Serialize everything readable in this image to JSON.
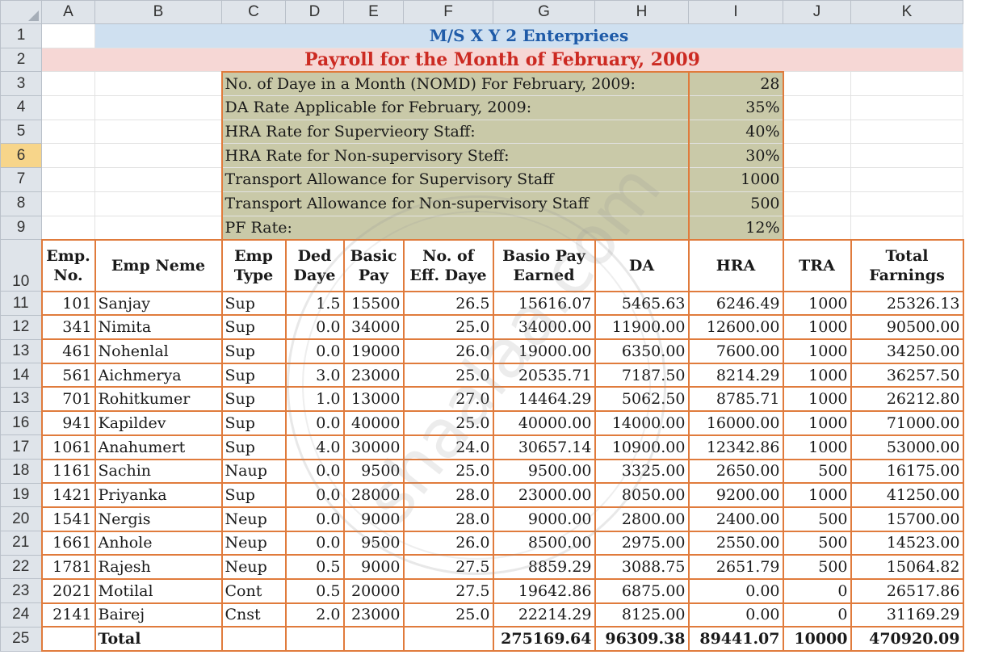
{
  "columns": [
    "A",
    "B",
    "C",
    "D",
    "E",
    "F",
    "G",
    "H",
    "I",
    "J",
    "K"
  ],
  "row_numbers": [
    "1",
    "2",
    "3",
    "4",
    "5",
    "6",
    "7",
    "8",
    "9",
    "10",
    "11",
    "12",
    "13",
    "14",
    "13",
    "16",
    "17",
    "18",
    "19",
    "20",
    "21",
    "22",
    "23",
    "24",
    "25"
  ],
  "selected_row_header": "6",
  "title": "M/S X Y 2 Enterpriees",
  "subtitle": "Payroll for the Month of February, 2009",
  "params": [
    {
      "label": "No. of Daye in a Month (NOMD) For February, 2009:",
      "value": "28"
    },
    {
      "label": "DA Rate Applicable for February, 2009:",
      "value": "35%"
    },
    {
      "label": "HRA Rate for Supervieory Staff:",
      "value": "40%"
    },
    {
      "label": "HRA Rate for Non-supervisory Steff:",
      "value": "30%"
    },
    {
      "label": "Transport Allowance for Supervisory Staff",
      "value": "1000"
    },
    {
      "label": "Transport Allowance for Non-supervisory Staff",
      "value": "500"
    },
    {
      "label": "PF Rate:",
      "value": "12%"
    }
  ],
  "headers": [
    "Emp. No.",
    "Emp Neme",
    "Emp Type",
    "Ded Daye",
    "Basic Pay",
    "No. of Eff. Daye",
    "Basio Pay Earned",
    "DA",
    "HRA",
    "TRA",
    "Total Farnings"
  ],
  "rows": [
    [
      "101",
      "Sanjay",
      "Sup",
      "1.5",
      "15500",
      "26.5",
      "15616.07",
      "5465.63",
      "6246.49",
      "1000",
      "25326.13"
    ],
    [
      "341",
      "Nimita",
      "Sup",
      "0.0",
      "34000",
      "25.0",
      "34000.00",
      "11900.00",
      "12600.00",
      "1000",
      "90500.00"
    ],
    [
      "461",
      "Nohenlal",
      "Sup",
      "0.0",
      "19000",
      "26.0",
      "19000.00",
      "6350.00",
      "7600.00",
      "1000",
      "34250.00"
    ],
    [
      "561",
      "Aichmerya",
      "Sup",
      "3.0",
      "23000",
      "25.0",
      "20535.71",
      "7187.50",
      "8214.29",
      "1000",
      "36257.50"
    ],
    [
      "701",
      "Rohitkumer",
      "Sup",
      "1.0",
      "13000",
      "27.0",
      "14464.29",
      "5062.50",
      "8785.71",
      "1000",
      "26212.80"
    ],
    [
      "941",
      "Kapildev",
      "Sup",
      "0.0",
      "40000",
      "25.0",
      "40000.00",
      "14000.00",
      "16000.00",
      "1000",
      "71000.00"
    ],
    [
      "1061",
      "Anahumert",
      "Sup",
      "4.0",
      "30000",
      "24.0",
      "30657.14",
      "10900.00",
      "12342.86",
      "1000",
      "53000.00"
    ],
    [
      "1161",
      "Sachin",
      "Naup",
      "0.0",
      "9500",
      "25.0",
      "9500.00",
      "3325.00",
      "2650.00",
      "500",
      "16175.00"
    ],
    [
      "1421",
      "Priyanka",
      "Sup",
      "0.0",
      "28000",
      "28.0",
      "23000.00",
      "8050.00",
      "9200.00",
      "1000",
      "41250.00"
    ],
    [
      "1541",
      "Nergis",
      "Neup",
      "0.0",
      "9000",
      "28.0",
      "9000.00",
      "2800.00",
      "2400.00",
      "500",
      "15700.00"
    ],
    [
      "1661",
      "Anhole",
      "Neup",
      "0.0",
      "9500",
      "26.0",
      "8500.00",
      "2975.00",
      "2550.00",
      "500",
      "14523.00"
    ],
    [
      "1781",
      "Rajesh",
      "Neup",
      "0.5",
      "9000",
      "27.5",
      "8859.29",
      "3088.75",
      "2651.79",
      "500",
      "15064.82"
    ],
    [
      "2021",
      "Motilal",
      "Cont",
      "0.5",
      "20000",
      "27.5",
      "19642.86",
      "6875.00",
      "0.00",
      "0",
      "26517.86"
    ],
    [
      "2141",
      "Bairej",
      "Cnst",
      "2.0",
      "23000",
      "25.0",
      "22214.29",
      "8125.00",
      "0.00",
      "0",
      "31169.29"
    ]
  ],
  "totals": {
    "label": "Total",
    "basic_pay_earned": "275169.64",
    "da": "96309.38",
    "hra": "89441.07",
    "tra": "10000",
    "total_earnings": "470920.09"
  },
  "colors": {
    "border_accent": "#e07b3c",
    "title_blue": "#1f5ba8",
    "subtitle_red": "#cc2a22",
    "param_fill": "#c9c9a8"
  }
}
